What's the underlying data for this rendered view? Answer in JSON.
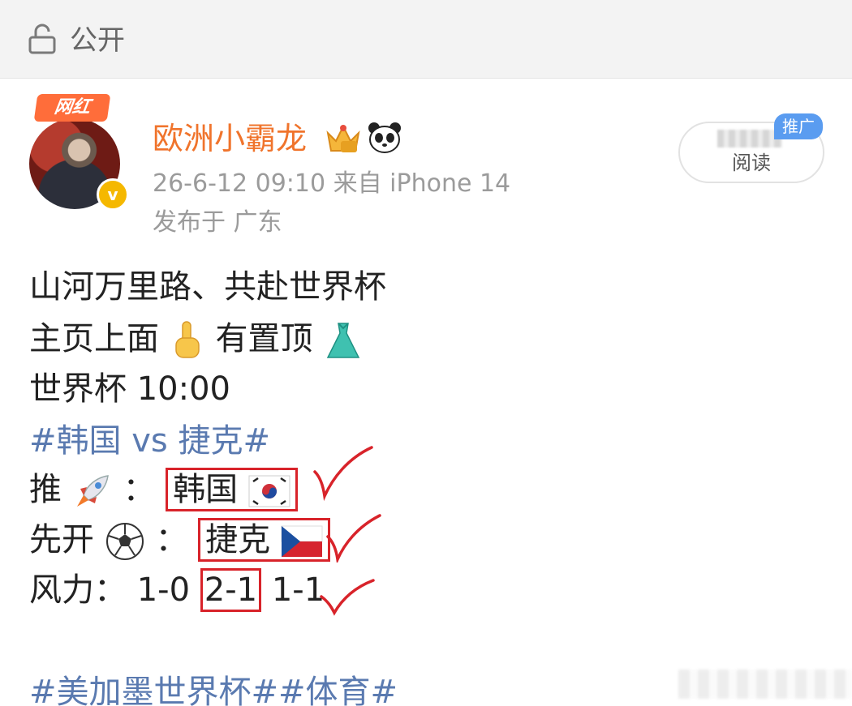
{
  "header": {
    "visibility_label": "公开",
    "lock_icon": "lock-icon"
  },
  "author": {
    "badge_label": "网红",
    "name": "欧洲小霸龙",
    "verified_icon": "verified-icon",
    "badge_icons": [
      "crown-icon",
      "panda-icon"
    ],
    "meta": "26-6-12 09:10  来自 iPhone 14",
    "location": "发布于 广东"
  },
  "read_pill": {
    "label": "阅读",
    "promo_badge": "推广"
  },
  "post": {
    "line1": "山河万里路、共赴世界杯",
    "line2_a": "主页上面",
    "line2_b": "有置顶",
    "line3": "世界杯 10:00",
    "tag1": "#韩国 vs 捷克#",
    "pick_label": "推",
    "pick_sep": "：",
    "pick_value": "韩国",
    "first_label": "先开",
    "first_sep": "：",
    "first_value": "捷克",
    "wind_label": "风力：",
    "wind_a": "1-0",
    "wind_b": "2-1",
    "wind_c": "1-1",
    "tag2": "#美加墨世界杯##体育#"
  },
  "colors": {
    "username": "#f0742c",
    "tag": "#5a7ab0",
    "annotation": "#d8232a"
  }
}
